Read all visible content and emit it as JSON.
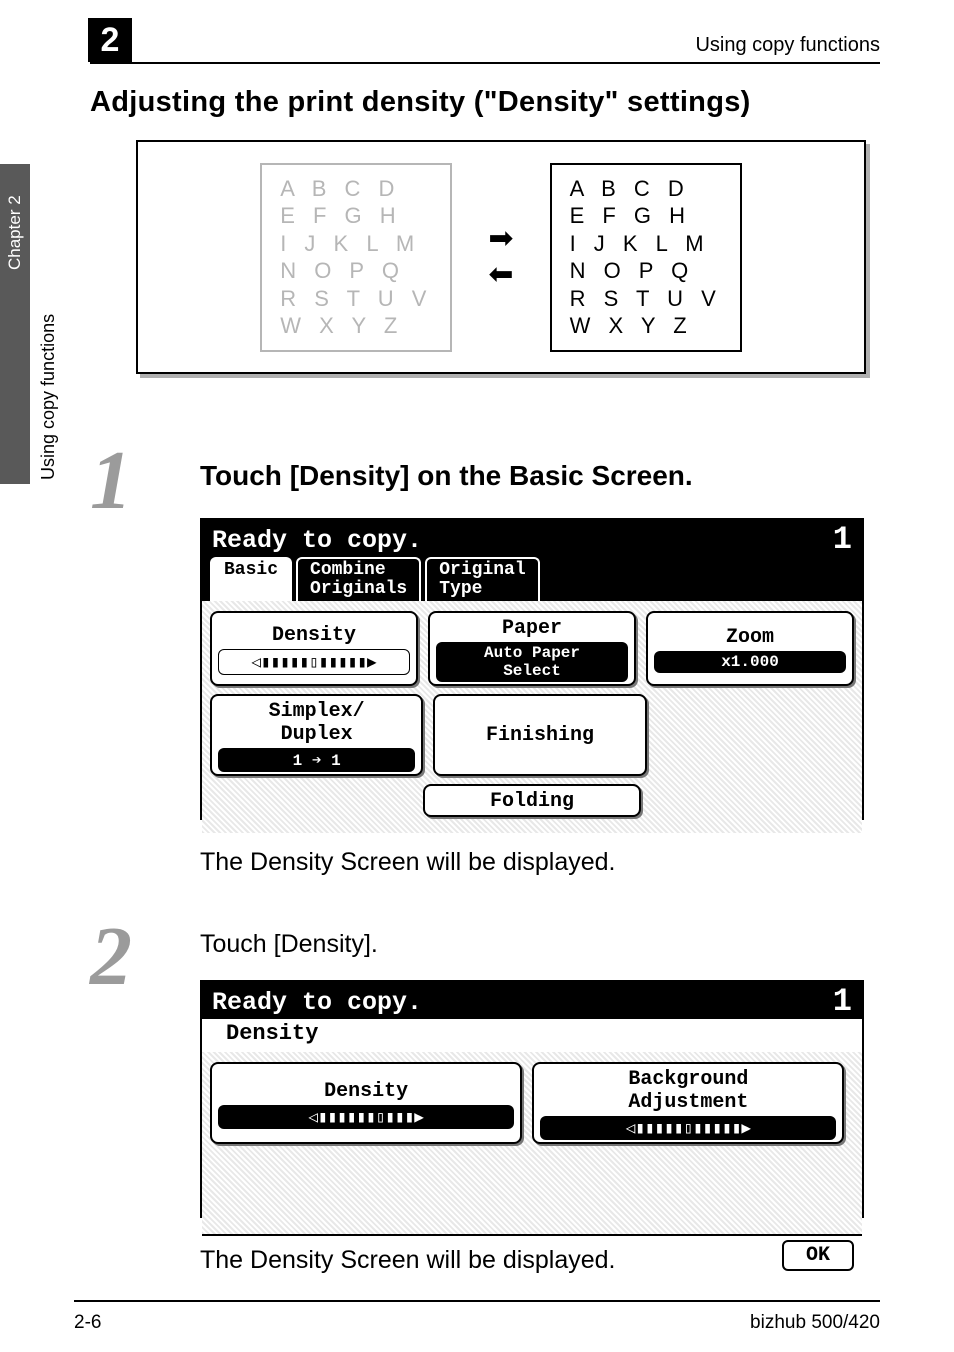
{
  "header": {
    "chapter_badge": "2",
    "right_text": "Using copy functions"
  },
  "sidebar": {
    "chapter_label": "Chapter 2",
    "section_label": "Using copy functions"
  },
  "section_title": "Adjusting the print density (\"Density\" settings)",
  "illustration": {
    "left_lines": [
      "A B C D",
      "E F G H",
      "I J K L M",
      "N O P Q",
      "R S T U V",
      "W X Y Z"
    ],
    "right_lines": [
      "A B C D",
      "E F G H",
      "I J K L M",
      "N O P Q",
      "R S T U V",
      "W X Y Z"
    ]
  },
  "steps": {
    "s1": {
      "num": "1",
      "title": "Touch [Density] on the Basic Screen.",
      "after": "The Density Screen will be displayed."
    },
    "s2": {
      "num": "2",
      "title": "Touch [Density].",
      "after": "The Density Screen will be displayed."
    }
  },
  "lcd1": {
    "status": "Ready to copy.",
    "count": "1",
    "tabs": [
      {
        "label": "Basic",
        "active": true
      },
      {
        "label": "Combine\nOriginals",
        "active": false
      },
      {
        "label": "Original\nType",
        "active": false
      }
    ],
    "buttons_row1": [
      {
        "label": "Density",
        "sub": "◁▮▮▮▮▮▯▮▮▮▮▮▶",
        "sub_style": "white"
      },
      {
        "label": "Paper",
        "sub": "Auto Paper\nSelect",
        "sub_style": "black"
      },
      {
        "label": "Zoom",
        "sub": "x1.000",
        "sub_style": "black"
      }
    ],
    "buttons_row2": [
      {
        "label": "Simplex/\nDuplex",
        "sub": "1 ➔ 1",
        "sub_style": "black"
      },
      {
        "label": "Finishing"
      },
      {
        "label": ""
      }
    ],
    "buttons_row3": [
      {
        "label": ""
      },
      {
        "label": "Folding"
      },
      {
        "label": ""
      }
    ]
  },
  "lcd2": {
    "status": "Ready to copy.",
    "count": "1",
    "title": "Density",
    "buttons": [
      {
        "label": "Density",
        "sub": "◁▮▮▮▮▮▮▯▮▮▮▶"
      },
      {
        "label": "Background\nAdjustment",
        "sub": "◁▮▮▮▮▮▯▮▮▮▮▮▶"
      }
    ],
    "ok": "OK"
  },
  "footer": {
    "left": "2-6",
    "right": "bizhub 500/420"
  }
}
